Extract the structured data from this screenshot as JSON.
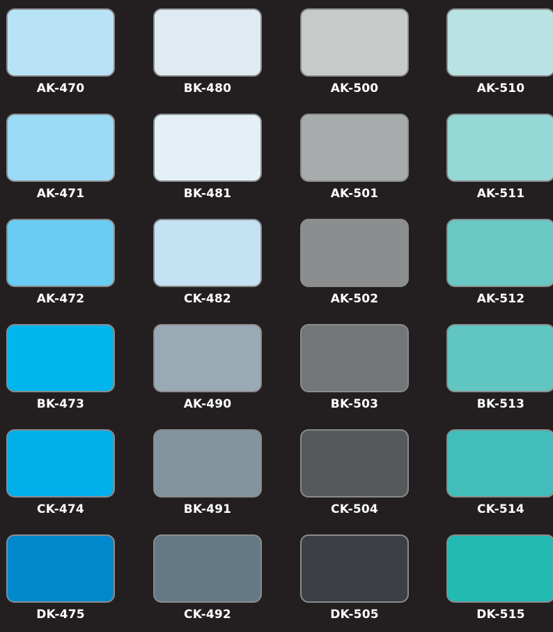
{
  "swatches": [
    {
      "code": "AK-470",
      "color": "#b8e3f7"
    },
    {
      "code": "BK-480",
      "color": "#e0eaf3"
    },
    {
      "code": "AK-500",
      "color": "#c8caca"
    },
    {
      "code": "AK-510",
      "color": "#b9e2e2"
    },
    {
      "code": "AK-471",
      "color": "#9bdbf5"
    },
    {
      "code": "BK-481",
      "color": "#e4eff8"
    },
    {
      "code": "AK-501",
      "color": "#a7abac"
    },
    {
      "code": "AK-511",
      "color": "#96d8d6"
    },
    {
      "code": "AK-472",
      "color": "#69cdf3"
    },
    {
      "code": "CK-482",
      "color": "#c5e1f4"
    },
    {
      "code": "AK-502",
      "color": "#8b8d8f"
    },
    {
      "code": "AK-512",
      "color": "#69c8c4"
    },
    {
      "code": "BK-473",
      "color": "#00b6ec"
    },
    {
      "code": "AK-490",
      "color": "#9aaab5"
    },
    {
      "code": "BK-503",
      "color": "#727679"
    },
    {
      "code": "BK-513",
      "color": "#61c6c1"
    },
    {
      "code": "CK-474",
      "color": "#00aeea"
    },
    {
      "code": "BK-491",
      "color": "#82959f"
    },
    {
      "code": "CK-504",
      "color": "#55595b"
    },
    {
      "code": "CK-514",
      "color": "#42bdb9"
    },
    {
      "code": "DK-475",
      "color": "#0088cc"
    },
    {
      "code": "CK-492",
      "color": "#657886"
    },
    {
      "code": "DK-505",
      "color": "#3c4045"
    },
    {
      "code": "DK-515",
      "color": "#22bab1"
    }
  ]
}
